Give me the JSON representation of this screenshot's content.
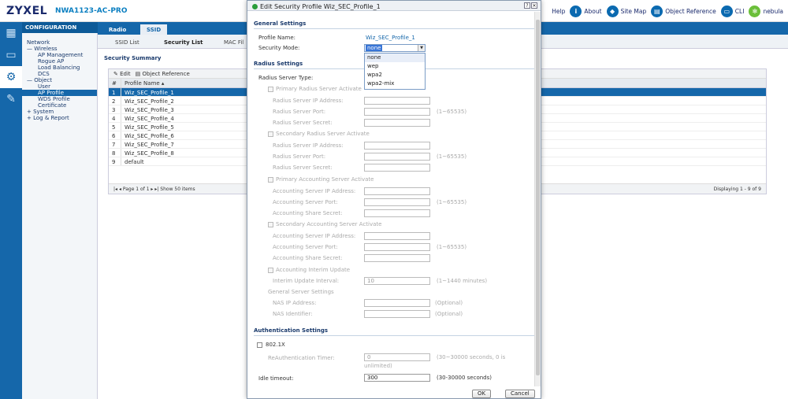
{
  "header": {
    "logo": "ZYXEL",
    "model": "NWA1123-AC-PRO",
    "links": [
      {
        "label": "Help",
        "icon": "i"
      },
      {
        "label": "About",
        "icon": "i"
      },
      {
        "label": "Site Map",
        "icon": "◆"
      },
      {
        "label": "Object Reference",
        "icon": "▤"
      },
      {
        "label": "CLI",
        "icon": "▭"
      },
      {
        "label": "nebula",
        "icon": "✻"
      }
    ]
  },
  "nav": {
    "title": "CONFIGURATION",
    "items": [
      {
        "label": "Network",
        "level": 0
      },
      {
        "label": "— Wireless",
        "level": 0
      },
      {
        "label": "AP Management",
        "level": 2
      },
      {
        "label": "Rogue AP",
        "level": 2
      },
      {
        "label": "Load Balancing",
        "level": 2
      },
      {
        "label": "DCS",
        "level": 2
      },
      {
        "label": "— Object",
        "level": 0
      },
      {
        "label": "User",
        "level": 2
      },
      {
        "label": "AP Profile",
        "level": 2
      },
      {
        "label": "WDS Profile",
        "level": 2
      },
      {
        "label": "Certificate",
        "level": 2
      },
      {
        "label": "+ System",
        "level": 0
      },
      {
        "label": "+ Log & Report",
        "level": 0
      }
    ]
  },
  "tabs": {
    "radio": "Radio",
    "ssid": "SSID"
  },
  "subtabs": {
    "ssid_list": "SSID List",
    "security_list": "Security List",
    "mac_filter": "MAC Fil"
  },
  "summary": {
    "title": "Security Summary",
    "edit": "Edit",
    "object_reference": "Object Reference",
    "col_num": "#",
    "col_name": "Profile Name ▴",
    "rows": [
      {
        "n": "1",
        "name": "Wiz_SEC_Profile_1"
      },
      {
        "n": "2",
        "name": "Wiz_SEC_Profile_2"
      },
      {
        "n": "3",
        "name": "Wiz_SEC_Profile_3"
      },
      {
        "n": "4",
        "name": "Wiz_SEC_Profile_4"
      },
      {
        "n": "5",
        "name": "Wiz_SEC_Profile_5"
      },
      {
        "n": "6",
        "name": "Wiz_SEC_Profile_6"
      },
      {
        "n": "7",
        "name": "Wiz_SEC_Profile_7"
      },
      {
        "n": "8",
        "name": "Wiz_SEC_Profile_8"
      },
      {
        "n": "9",
        "name": "default"
      }
    ],
    "pager": "|◂ ◂ Page 1 of 1 ▸ ▸| Show 50 items",
    "displaying": "Displaying 1 - 9 of 9"
  },
  "modal": {
    "title": "Edit Security Profile Wiz_SEC_Profile_1",
    "general_settings": "General Settings",
    "profile_name_label": "Profile Name:",
    "profile_name_value": "Wiz_SEC_Profile_1",
    "security_mode_label": "Security Mode:",
    "security_mode_value": "none",
    "security_mode_options": [
      "none",
      "wep",
      "wpa2",
      "wpa2-mix"
    ],
    "radius_settings": "Radius Settings",
    "radius_server_type": "Radius Server Type:",
    "primary_radius": "Primary Radius Server Activate",
    "secondary_radius": "Secondary Radius Server Activate",
    "primary_accounting": "Primary Accounting Server Activate",
    "secondary_accounting": "Secondary Accounting Server Activate",
    "radius_ip": "Radius Server IP Address:",
    "radius_port": "Radius Server Port:",
    "radius_secret": "Radius Server Secret:",
    "acc_ip": "Accounting Server IP Address:",
    "acc_port": "Accounting Server Port:",
    "acc_secret": "Accounting Share Secret:",
    "port_hint": "(1~65535)",
    "acc_interim": "Accounting Interim Update",
    "interim_interval": "Interim Update Interval:",
    "interim_value": "10",
    "interim_hint": "(1~1440 minutes)",
    "general_server": "General Server Settings",
    "nas_ip": "NAS IP Address:",
    "nas_id": "NAS Identifier:",
    "optional": "(Optional)",
    "auth_settings": "Authentication Settings",
    "dot1x": "802.1X",
    "reauth_label": "ReAuthentication Timer:",
    "reauth_value": "0",
    "reauth_hint": "(30~30000 seconds, 0 is",
    "reauth_hint2": "unlimited)",
    "idle_label": "Idle timeout:",
    "idle_value": "300",
    "idle_hint": "(30-30000 seconds)",
    "ok": "OK",
    "cancel": "Cancel"
  }
}
